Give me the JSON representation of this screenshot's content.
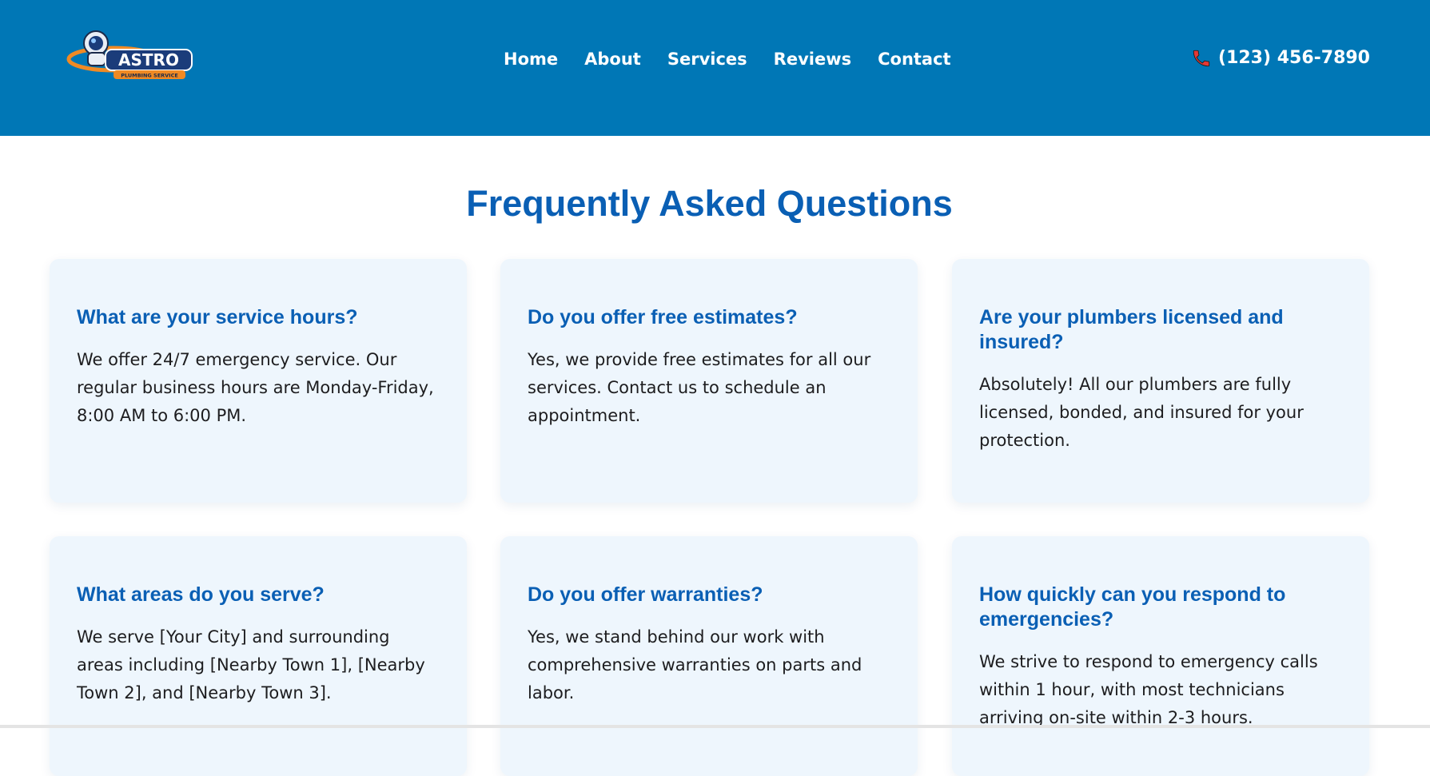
{
  "header": {
    "logo": {
      "brand": "ASTRO",
      "tagline": "PLUMBING SERVICE"
    },
    "nav": [
      {
        "label": "Home"
      },
      {
        "label": "About"
      },
      {
        "label": "Services"
      },
      {
        "label": "Reviews"
      },
      {
        "label": "Contact"
      }
    ],
    "phone": {
      "icon": "phone-icon",
      "number": "(123) 456-7890"
    },
    "colors": {
      "background": "#0077b6",
      "text": "#ffffff"
    }
  },
  "faq": {
    "title": "Frequently Asked Questions",
    "items": [
      {
        "question": "What are your service hours?",
        "answer": "We offer 24/7 emergency service. Our regular business hours are Monday-Friday, 8:00 AM to 6:00 PM."
      },
      {
        "question": "Do you offer free estimates?",
        "answer": "Yes, we provide free estimates for all our services. Contact us to schedule an appointment."
      },
      {
        "question": "Are your plumbers licensed and insured?",
        "answer": "Absolutely! All our plumbers are fully licensed, bonded, and insured for your protection."
      },
      {
        "question": "What areas do you serve?",
        "answer": "We serve [Your City] and surrounding areas including [Nearby Town 1], [Nearby Town 2], and [Nearby Town 3]."
      },
      {
        "question": "Do you offer warranties?",
        "answer": "Yes, we stand behind our work with comprehensive warranties on parts and labor."
      },
      {
        "question": "How quickly can you respond to emergencies?",
        "answer": "We strive to respond to emergency calls within 1 hour, with most technicians arriving on-site within 2-3 hours."
      }
    ],
    "colors": {
      "heading": "#0a5fb4",
      "card_background": "#eef6fd",
      "body_text": "#1d1d1f"
    }
  }
}
